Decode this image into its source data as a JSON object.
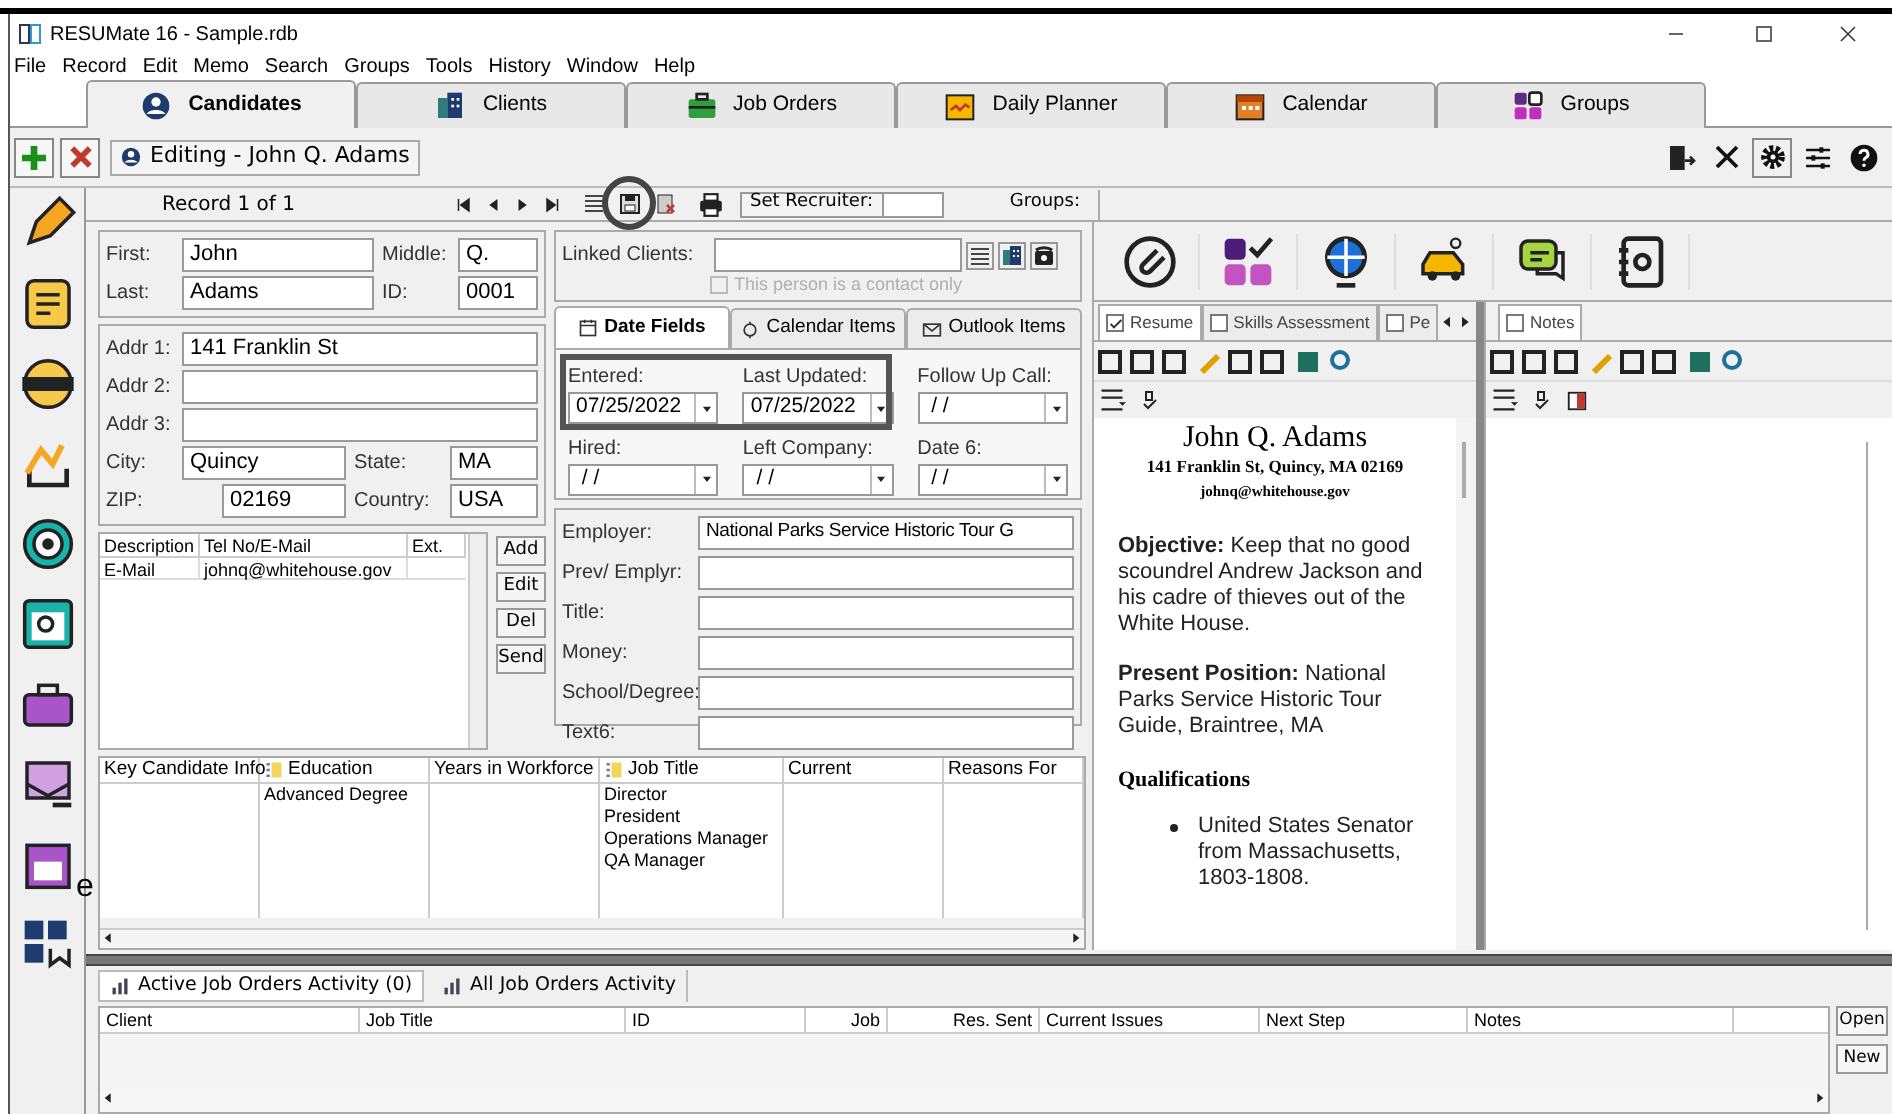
{
  "window": {
    "title": "RESUMate 16 - Sample.rdb"
  },
  "menu": [
    "File",
    "Record",
    "Edit",
    "Memo",
    "Search",
    "Groups",
    "Tools",
    "History",
    "Window",
    "Help"
  ],
  "main_tabs": [
    {
      "label": "Candidates",
      "selected": true
    },
    {
      "label": "Clients",
      "selected": false
    },
    {
      "label": "Job Orders",
      "selected": false
    },
    {
      "label": "Daily Planner",
      "selected": false
    },
    {
      "label": "Calendar",
      "selected": false
    },
    {
      "label": "Groups",
      "selected": false
    }
  ],
  "editing_label": "Editing  - John Q. Adams",
  "record_bar": {
    "record": "Record 1 of 1",
    "set_recruiter": "Set Recruiter:",
    "groups": "Groups:"
  },
  "name_fields": [
    {
      "label": "First:",
      "value": "John"
    },
    {
      "label": "Middle:",
      "value": "Q."
    },
    {
      "label": "Last:",
      "value": "Adams"
    },
    {
      "label": "ID:",
      "value": "0001"
    }
  ],
  "address_fields": [
    {
      "label": "Addr 1:",
      "value": "141 Franklin St"
    },
    {
      "label": "Addr 2:"
    },
    {
      "label": "Addr 3:"
    },
    {
      "label": "City:",
      "value": "Quincy"
    },
    {
      "label": "State:",
      "value": "MA"
    },
    {
      "label": "ZIP:",
      "value": "02169"
    },
    {
      "label": "Country:",
      "value": "USA"
    }
  ],
  "linked_clients": {
    "label": "Linked Clients:",
    "contact_only": {
      "label": "This person is a contact only",
      "checked": false,
      "disabled": true
    }
  },
  "date_tabs": [
    {
      "label": "Date Fields",
      "selected": true
    },
    {
      "label": "Calendar Items",
      "selected": false
    },
    {
      "label": "Outlook Items",
      "selected": false
    }
  ],
  "date_fields": [
    {
      "label": "Entered:",
      "value": "07/25/2022"
    },
    {
      "label": "Last Updated:",
      "value": "07/25/2022"
    },
    {
      "label": "Follow Up Call:",
      "value": " / /"
    },
    {
      "label": "Hired:",
      "value": " / /"
    },
    {
      "label": "Left Company:",
      "value": " / /"
    },
    {
      "label": "Date 6:",
      "value": " / /"
    }
  ],
  "contacts": {
    "columns": [
      "Description",
      "Tel No/E-Mail",
      "Ext."
    ],
    "rows": [
      {
        "description": "E-Mail",
        "value": "johnq@whitehouse.gov"
      }
    ]
  },
  "contact_buttons": [
    "Add",
    "Edit",
    "Del",
    "Send"
  ],
  "employment_fields": [
    {
      "label": "Employer:",
      "value": "National Parks Service Historic Tour G"
    },
    {
      "label": "Prev/ Emplyr:"
    },
    {
      "label": "Title:"
    },
    {
      "label": "Money:"
    },
    {
      "label": "School/Degree:"
    },
    {
      "label": "Text6:"
    }
  ],
  "info_grid": {
    "columns": [
      {
        "label": "Key Candidate Info"
      },
      {
        "label": "Education",
        "items": [
          "Advanced Degree"
        ]
      },
      {
        "label": "Years in Workforce"
      },
      {
        "label": "Job Title",
        "items": [
          "Director",
          "President",
          "Operations Manager",
          "QA Manager"
        ]
      },
      {
        "label": "Current"
      },
      {
        "label": "Reasons For"
      }
    ]
  },
  "doc_tabs": [
    {
      "label": "Resume",
      "checked": true,
      "selected": true
    },
    {
      "label": "Skills Assessment",
      "checked": false,
      "selected": false
    },
    {
      "label": "Pe",
      "checked": false,
      "selected": false
    }
  ],
  "notes_tab": {
    "label": "Notes",
    "checked": false
  },
  "resume": {
    "name": "John Q. Adams",
    "address": "141 Franklin St, Quincy, MA 02169",
    "email": "johnq@whitehouse.gov",
    "paragraphs": [
      "**Objective:** Keep that no good scoundrel Andrew Jackson and his cadre of thieves out of the White House.",
      "**Present Position:** National Parks Service Historic Tour Guide, Braintree, MA"
    ],
    "qualifications_heading": "Qualifications",
    "qualifications": [
      "United States Senator from Massachusetts, 1803-1808."
    ]
  },
  "activity_tabs": [
    {
      "label": "Active Job Orders Activity (0)",
      "selected": true
    },
    {
      "label": "All Job Orders Activity",
      "selected": false
    }
  ],
  "activity_columns": [
    "Client",
    "Job Title",
    "ID",
    "Job",
    "Res. Sent",
    "Current Issues",
    "Next Step",
    "Notes"
  ],
  "activity_buttons": [
    "Open",
    "New"
  ],
  "annotation_fragment": "e"
}
